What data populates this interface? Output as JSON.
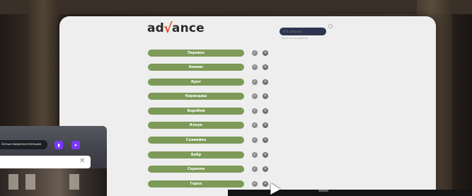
{
  "app": {
    "logo_prefix": "ad",
    "logo_v": "√",
    "logo_suffix": "ance",
    "search_placeholder": "Всё запросы",
    "search_hint": "Поиск по всем работам"
  },
  "items": [
    {
      "label": "Паровоз"
    },
    {
      "label": "Ананас"
    },
    {
      "label": "Крот"
    },
    {
      "label": "Карандаш"
    },
    {
      "label": "Воробей"
    },
    {
      "label": "Клоун"
    },
    {
      "label": "Скамейка"
    },
    {
      "label": "Бобр"
    },
    {
      "label": "Скрепка"
    },
    {
      "label": "Горох"
    }
  ],
  "icons": {
    "confirm": "check-circle-icon",
    "delete": "close-circle-icon",
    "confirm_glyph": "✓",
    "delete_glyph": "×"
  },
  "overlay": {
    "bar_text": "ённые видеоколлекции",
    "chart_glyph": "▮",
    "send_glyph": "➤",
    "close_glyph": "✕"
  },
  "colors": {
    "pill": "#7d9a58",
    "search": "#2e3550",
    "accent_purple": "#7a36ff",
    "logo_v": "#e8502a"
  }
}
